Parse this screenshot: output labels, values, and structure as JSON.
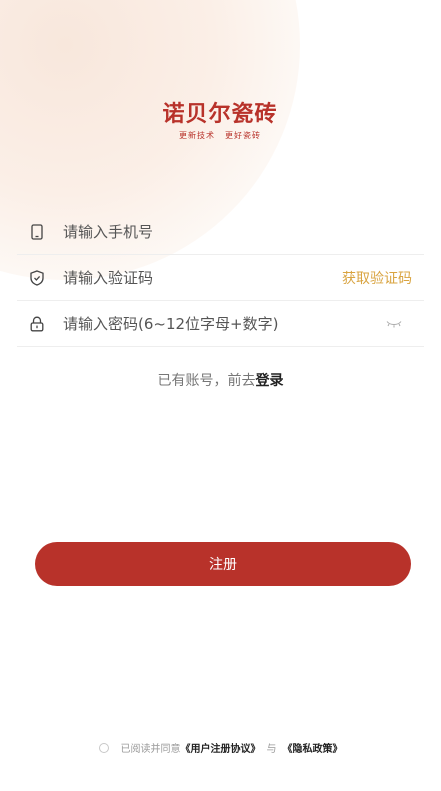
{
  "brand": {
    "name": "诺贝尔瓷砖",
    "slogan_left": "更新技术",
    "slogan_right": "更好瓷砖",
    "color": "#b8322a"
  },
  "form": {
    "phone_placeholder": "请输入手机号",
    "code_placeholder": "请输入验证码",
    "get_code_label": "获取验证码",
    "password_placeholder": "请输入密码(6~12位字母+数字)"
  },
  "login_prompt": {
    "text": "已有账号，前去",
    "link": "登录"
  },
  "register_button": "注册",
  "agreement": {
    "prefix": "已阅读并同意",
    "user_agreement": "《用户注册协议》",
    "connector": "与",
    "privacy_policy": "《隐私政策》"
  },
  "icons": {
    "phone": "phone-icon",
    "code": "shield-icon",
    "password": "lock-icon",
    "toggle": "eye-closed-icon"
  },
  "colors": {
    "accent": "#b8322a",
    "code_link": "#d9a441"
  }
}
